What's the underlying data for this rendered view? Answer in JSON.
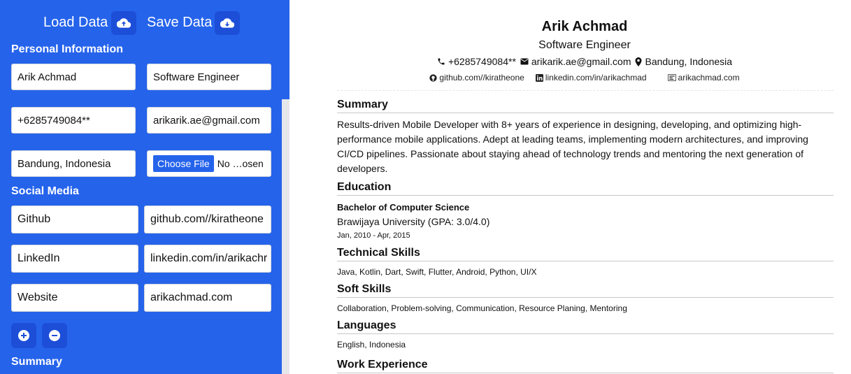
{
  "toolbar": {
    "load_label": "Load Data",
    "save_label": "Save Data"
  },
  "editor": {
    "personal_title": "Personal Information",
    "name": "Arik Achmad",
    "job_title": "Software Engineer",
    "phone": "+6285749084**",
    "email": "arikarik.ae@gmail.com",
    "location": "Bandung, Indonesia",
    "file_button": "Choose File",
    "file_status": "No …osen",
    "social_title": "Social Media",
    "social": [
      {
        "platform": "Github",
        "url": "github.com//kiratheone"
      },
      {
        "platform": "LinkedIn",
        "url": "linkedin.com/in/arikachr"
      },
      {
        "platform": "Website",
        "url": "arikachmad.com"
      }
    ],
    "summary_title": "Summary"
  },
  "resume": {
    "name": "Arik Achmad",
    "title": "Software Engineer",
    "phone": "+6285749084**",
    "email": "arikarik.ae@gmail.com",
    "location": "Bandung, Indonesia",
    "github": "github.com//kiratheone",
    "linkedin": "linkedin.com/in/arikachmad",
    "website": "arikachmad.com",
    "summary_heading": "Summary",
    "summary_text": "Results-driven Mobile Developer with 8+ years of experience in designing, developing, and optimizing high-performance mobile applications. Adept at leading teams, implementing modern architectures, and improving CI/CD pipelines. Passionate about staying ahead of technology trends and mentoring the next generation of developers.",
    "education_heading": "Education",
    "degree": "Bachelor of Computer Science",
    "university": "Brawijaya University (GPA: 3.0/4.0)",
    "edu_dates": "Jan, 2010 - Apr, 2015",
    "tech_heading": "Technical Skills",
    "tech_skills": "Java, Kotlin, Dart, Swift, Flutter, Android, Python, UI/X",
    "soft_heading": "Soft Skills",
    "soft_skills": "Collaboration, Problem-solving, Communication, Resource Planing, Mentoring",
    "lang_heading": "Languages",
    "languages": "English, Indonesia",
    "work_heading": "Work Experience"
  },
  "colors": {
    "panel": "#2563eb",
    "button": "#1d4ed8"
  }
}
